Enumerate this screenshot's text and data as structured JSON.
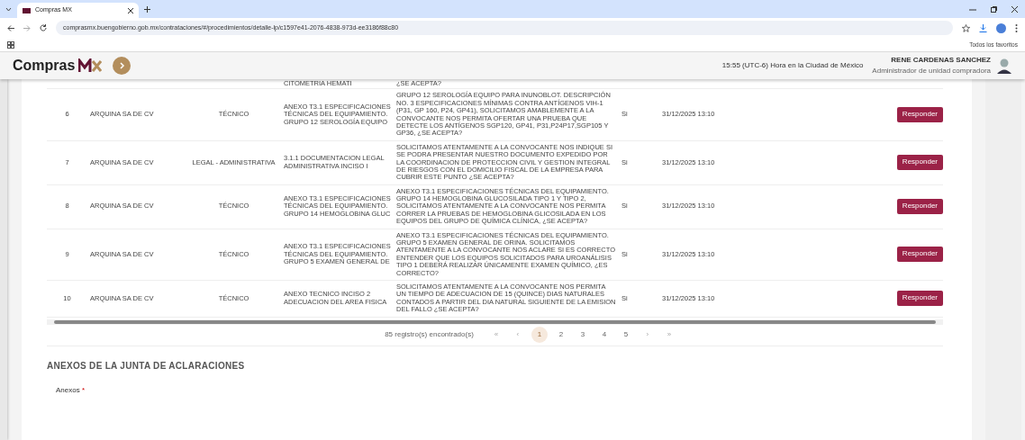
{
  "browser": {
    "tab_title": "Compras MX",
    "url": "comprasmx.buengobierno.gob.mx/contrataciones/#/procedimientos/detalle-lp/c1597e41-2076-4838-973d-ee3186f88c80",
    "bookmarks_label": "Todos los favoritos"
  },
  "header": {
    "logo_text": "Compras",
    "clock": "15:55 (UTC-6) Hora en la Ciudad de México",
    "user_name": "RENE CARDENAS SANCHEZ",
    "user_role": "Administrador de unidad compradora"
  },
  "partial_row": {
    "annex": "CITOMETRIA HEMATI",
    "question": "¿SE ACEPTA?"
  },
  "rows": [
    {
      "number": "6",
      "company": "ARQUINA SA DE CV",
      "type": "TÉCNICO",
      "annex": "ANEXO T3.1 ESPECIFICACIONES TÉCNICAS DEL EQUIPAMIENTO. GRUPO 12 SEROLOGÍA EQUIPO",
      "question": "GRUPO 12 SEROLOGÍA EQUIPO PARA INUNOBLOT. DESCRIPCIÓN NO. 3 ESPECIFICACIONES MÍNIMAS CONTRA ANTÍGENOS VIH-1 (P31, GP 160, P24, GP41), SOLICITAMOS AMABLEMENTE A LA CONVOCANTE NOS PERMITA OFERTAR UNA PRUEBA QUE DETECTE LOS ANTÍGENOS SGP120, GP41, P31,P24P17,SGP105 Y GP36, ¿SE ACEPTA?",
      "answer": "Si",
      "date": "31/12/2025 13:10",
      "action": "Responder"
    },
    {
      "number": "7",
      "company": "ARQUINA SA DE CV",
      "type": "LEGAL - ADMINISTRATIVA",
      "annex": "3.1.1 DOCUMENTACION LEGAL ADMINISTRATIVA INCISO I",
      "question": "SOLICITAMOS ATENTAMENTE A LA CONVOCANTE NOS INDIQUE SI SE PODRA PRESENTAR NUESTRO DOCUMENTO EXPEDIDO POR LA COORDINACION DE PROTECCION CIVIL Y GESTION INTEGRAL DE RIESGOS CON EL DOMICILIO FISCAL DE LA EMPRESA PARA CUBRIR ESTE PUNTO ¿SE ACEPTA?",
      "answer": "Si",
      "date": "31/12/2025 13:10",
      "action": "Responder"
    },
    {
      "number": "8",
      "company": "ARQUINA SA DE CV",
      "type": "TÉCNICO",
      "annex": "ANEXO T3.1 ESPECIFICACIONES TÉCNICAS DEL EQUIPAMIENTO. GRUPO 14 HEMOGLOBINA GLUC",
      "question": "ANEXO T3.1 ESPECIFICACIONES TÉCNICAS DEL EQUIPAMIENTO. GRUPO 14 HEMOGLOBINA GLUCOSILADA TIPO 1 Y TIPO 2, SOLICITAMOS ATENTAMENTE A LA CONVOCANTE NOS PERMITA CORRER LA PRUEBAS DE HEMOGLOBINA GLICOSILADA EN LOS EQUIPOS DEL GRUPO DE QUÍMICA CLÍNICA, ¿SE ACEPTA?",
      "answer": "Si",
      "date": "31/12/2025 13:10",
      "action": "Responder"
    },
    {
      "number": "9",
      "company": "ARQUINA SA DE CV",
      "type": "TÉCNICO",
      "annex": "ANEXO T3.1 ESPECIFICACIONES TÉCNICAS DEL EQUIPAMIENTO. GRUPO 5 EXAMEN GENERAL DE",
      "question": "ANEXO T3.1 ESPECIFICACIONES TÉCNICAS DEL EQUIPAMIENTO. GRUPO 5 EXAMEN GENERAL DE ORINA. SOLICITAMOS ATENTAMENTE A LA CONVOCANTE NOS ACLARE SI ES CORRECTO ENTENDER QUE LOS EQUIPOS SOLICITADOS PARA UROANÁLISIS TIPO 1 DEBERÁ REALIZAR ÚNICAMENTE EXAMEN QUÍMICO, ¿ES CORRECTO?",
      "answer": "Si",
      "date": "31/12/2025 13:10",
      "action": "Responder"
    },
    {
      "number": "10",
      "company": "ARQUINA SA DE CV",
      "type": "TÉCNICO",
      "annex": "ANEXO TECNICO INCISO 2 ADECUACION DEL AREA FISICA",
      "question": "SOLICITAMOS ATENTAMENTE A LA CONVOCANTE NOS PERMITA UN TIEMPO DE ADECUACION DE 15 (QUINCE) DIAS NATURALES CONTADOS A PARTIR DEL DIA NATURAL SIGUIENTE DE LA EMISION DEL FALLO ¿SE ACEPTA?",
      "answer": "Si",
      "date": "31/12/2025 13:10",
      "action": "Responder"
    }
  ],
  "pagination": {
    "summary": "85 registro(s) encontrado(s)",
    "pages": [
      {
        "label": "«",
        "kind": "nav",
        "selected": false
      },
      {
        "label": "‹",
        "kind": "nav",
        "selected": false
      },
      {
        "label": "1",
        "kind": "page",
        "selected": true
      },
      {
        "label": "2",
        "kind": "page",
        "selected": false
      },
      {
        "label": "3",
        "kind": "page",
        "selected": false
      },
      {
        "label": "4",
        "kind": "page",
        "selected": false
      },
      {
        "label": "5",
        "kind": "page",
        "selected": false
      },
      {
        "label": "›",
        "kind": "nav",
        "selected": false
      },
      {
        "label": "»",
        "kind": "nav",
        "selected": false
      }
    ]
  },
  "section": {
    "title": "ANEXOS DE LA JUNTA DE ACLARACIONES",
    "field_label": "Anexos",
    "required_mark": "*"
  }
}
